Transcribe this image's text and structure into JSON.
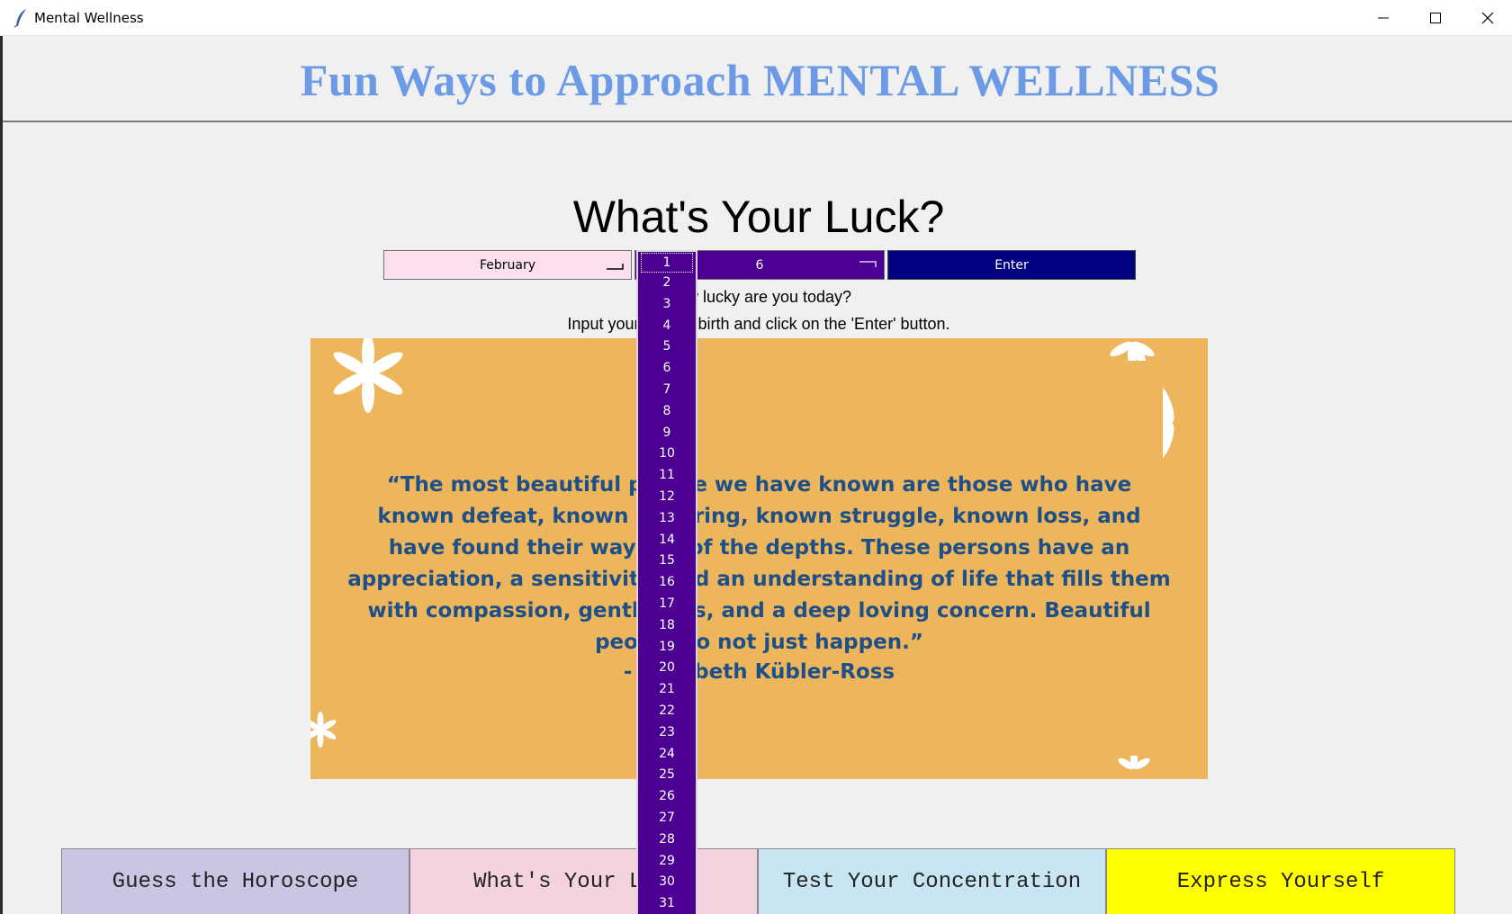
{
  "window": {
    "title": "Mental Wellness"
  },
  "header": {
    "title": "Fun Ways to Approach MENTAL WELLNESS"
  },
  "luck": {
    "heading": "What's Your Luck?",
    "month_value": "February",
    "day_value": "6",
    "enter_label": "Enter",
    "question": "How lucky are you today?",
    "instruction": "Input your date of birth and click on the 'Enter' button."
  },
  "quote": {
    "text": "“The most beautiful people we have known are those who have known defeat, known suffering, known struggle, known loss, and have found their way out of the depths. These persons have an appreciation, a sensitivity, and an understanding of life that fills them with compassion, gentleness, and a deep loving concern. Beautiful people do not just happen.”",
    "author": "- Elisabeth Kübler-Ross"
  },
  "day_dropdown": {
    "selected": "1",
    "options": [
      "1",
      "2",
      "3",
      "4",
      "5",
      "6",
      "7",
      "8",
      "9",
      "10",
      "11",
      "12",
      "13",
      "14",
      "15",
      "16",
      "17",
      "18",
      "19",
      "20",
      "21",
      "22",
      "23",
      "24",
      "25",
      "26",
      "27",
      "28",
      "29",
      "30",
      "31"
    ]
  },
  "nav": {
    "horoscope": "Guess the Horoscope",
    "luck": "What's Your Luck?",
    "concentration": "Test Your Concentration",
    "express": "Express Yourself"
  },
  "colors": {
    "heading_blue": "#6c9ae4",
    "day_purple": "#4b0092",
    "enter_navy": "#000080",
    "card_orange": "#edb65d",
    "quote_blue": "#1e4f86"
  },
  "icons": [
    "feather-icon",
    "minimize-icon",
    "maximize-icon",
    "close-icon",
    "dropdown-arrow-icon",
    "flower-decoration"
  ]
}
